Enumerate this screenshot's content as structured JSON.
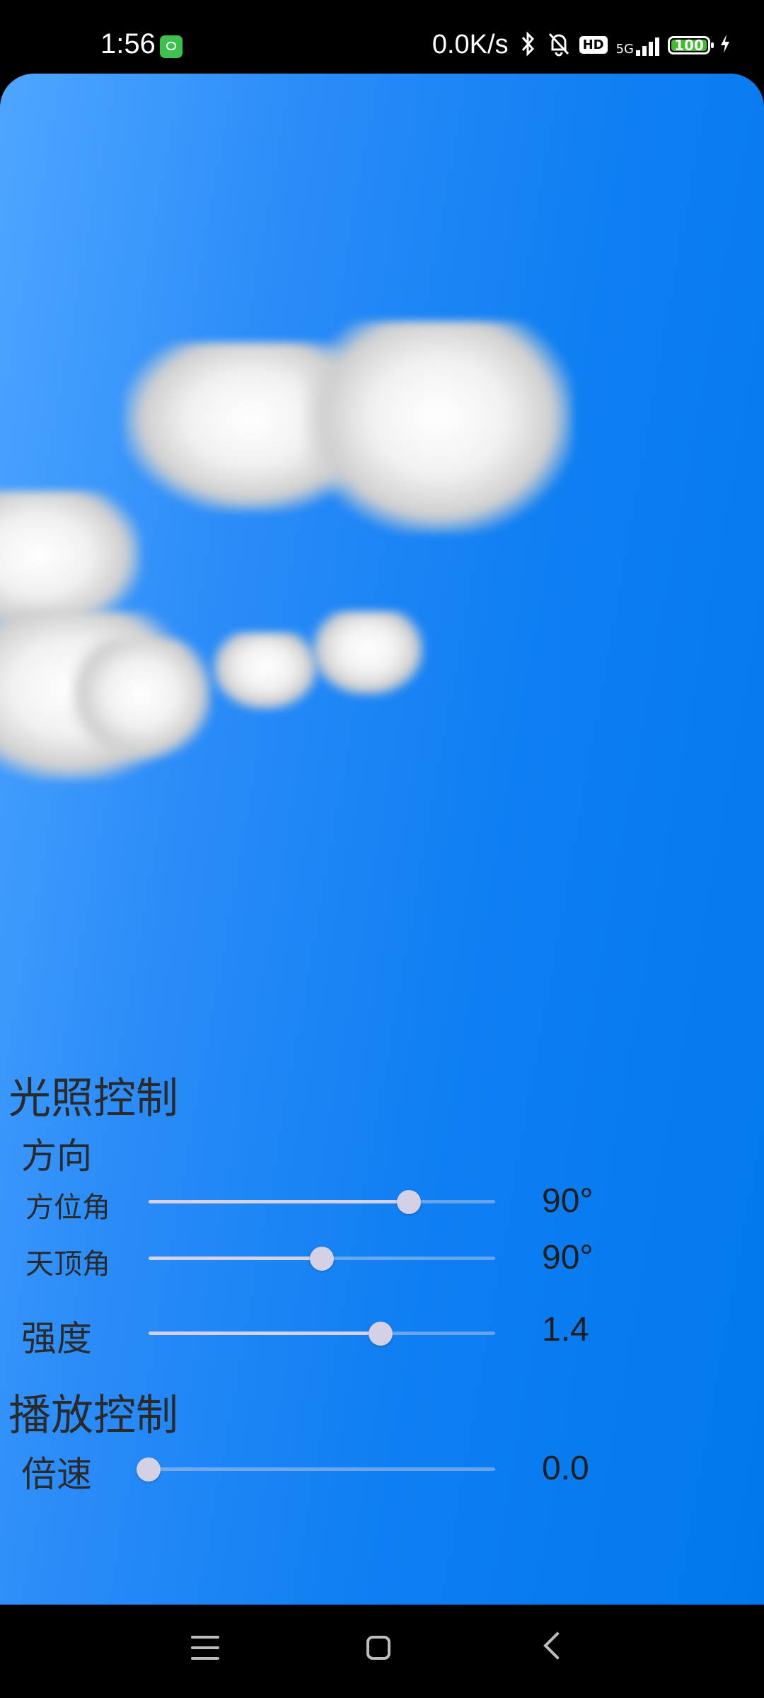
{
  "status_bar": {
    "time": "1:56",
    "net_speed": "0.0K/s",
    "network": "5G",
    "hd_label": "HD",
    "battery": "100",
    "icons": [
      "app-notification-icon",
      "bluetooth-icon",
      "mute-bell-icon",
      "hd-icon",
      "signal-5g-icon",
      "battery-icon",
      "charging-icon"
    ]
  },
  "light_control": {
    "title": "光照控制",
    "direction_label": "方向",
    "azimuth": {
      "label": "方位角",
      "value_text": "90°",
      "fraction": 0.75
    },
    "zenith": {
      "label": "天顶角",
      "value_text": "90°",
      "fraction": 0.5
    },
    "intensity": {
      "label": "强度",
      "value_text": "1.4",
      "fraction": 0.67
    }
  },
  "playback_control": {
    "title": "播放控制",
    "speed": {
      "label": "倍速",
      "value_text": "0.0",
      "fraction": 0.0
    }
  },
  "colors": {
    "sky_top": "#4ea6ff",
    "sky_deep": "#0078ec",
    "slider": "#d4d0e6"
  },
  "nav": {
    "icons": [
      "menu-icon",
      "home-icon",
      "back-icon"
    ]
  }
}
